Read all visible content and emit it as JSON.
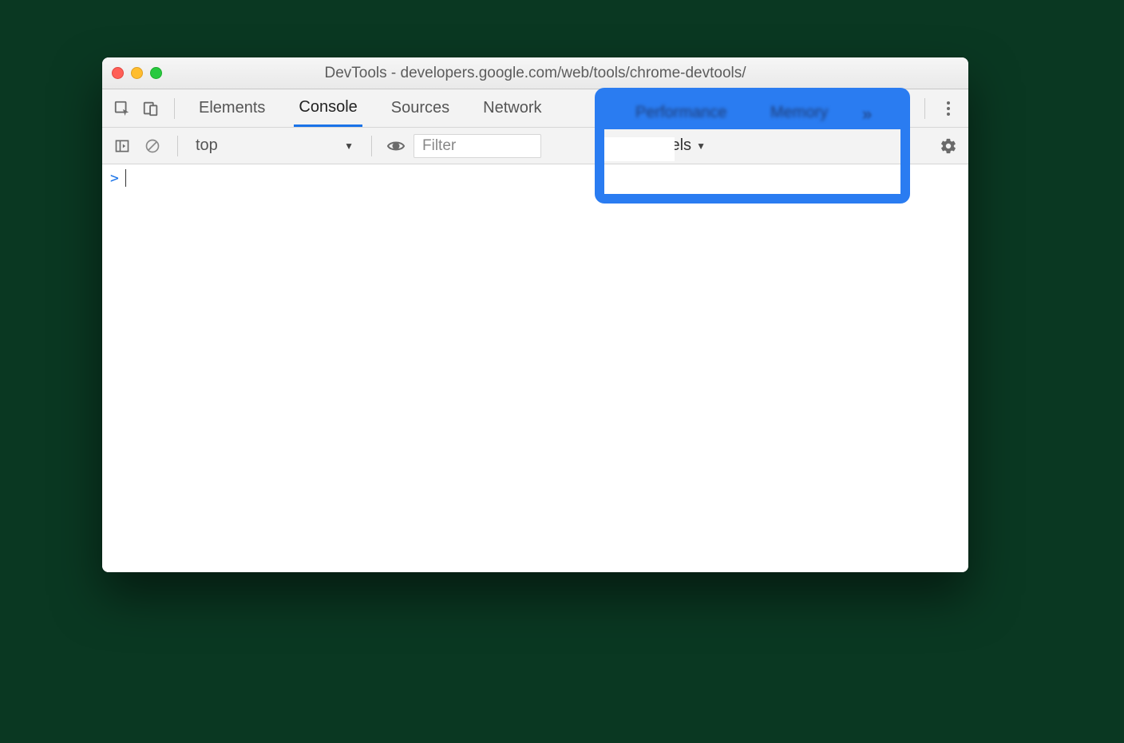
{
  "window": {
    "title": "DevTools - developers.google.com/web/tools/chrome-devtools/"
  },
  "tabs": {
    "items": [
      "Elements",
      "Console",
      "Sources",
      "Network",
      "Performance",
      "Memory"
    ],
    "active": "Console"
  },
  "filterbar": {
    "context": "top",
    "filter_placeholder": "Filter",
    "levels_label": "Default levels"
  },
  "console": {
    "prompt": ">"
  },
  "overlay": {
    "hidden_tab_performance": "Performance",
    "hidden_tab_memory": "Memory",
    "chevron": "»"
  }
}
